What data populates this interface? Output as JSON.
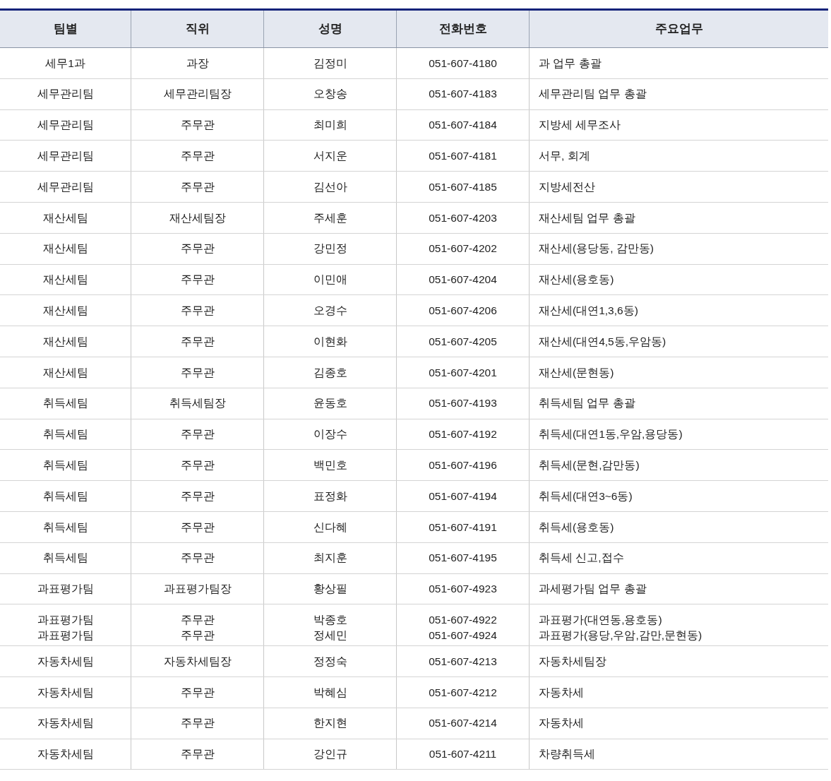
{
  "table": {
    "columns": [
      "팀별",
      "직위",
      "성명",
      "전화번호",
      "주요업무"
    ],
    "rows": [
      [
        "세무1과",
        "과장",
        "김정미",
        "051-607-4180",
        "과 업무 총괄"
      ],
      [
        "세무관리팀",
        "세무관리팀장",
        "오창송",
        "051-607-4183",
        "세무관리팀 업무 총괄"
      ],
      [
        "세무관리팀",
        "주무관",
        "최미희",
        "051-607-4184",
        "지방세 세무조사"
      ],
      [
        "세무관리팀",
        "주무관",
        "서지운",
        "051-607-4181",
        "서무, 회계"
      ],
      [
        "세무관리팀",
        "주무관",
        "김선아",
        "051-607-4185",
        "지방세전산"
      ],
      [
        "재산세팀",
        "재산세팀장",
        "주세훈",
        "051-607-4203",
        "재산세팀 업무 총괄"
      ],
      [
        "재산세팀",
        "주무관",
        "강민정",
        "051-607-4202",
        "재산세(용당동, 감만동)"
      ],
      [
        "재산세팀",
        "주무관",
        "이민애",
        "051-607-4204",
        "재산세(용호동)"
      ],
      [
        "재산세팀",
        "주무관",
        "오경수",
        "051-607-4206",
        "재산세(대연1,3,6동)"
      ],
      [
        "재산세팀",
        "주무관",
        "이현화",
        "051-607-4205",
        "재산세(대연4,5동,우암동)"
      ],
      [
        "재산세팀",
        "주무관",
        "김종호",
        "051-607-4201",
        "재산세(문현동)"
      ],
      [
        "취득세팀",
        "취득세팀장",
        "윤동호",
        "051-607-4193",
        "취득세팀 업무 총괄"
      ],
      [
        "취득세팀",
        "주무관",
        "이장수",
        "051-607-4192",
        "취득세(대연1동,우암,용당동)"
      ],
      [
        "취득세팀",
        "주무관",
        "백민호",
        "051-607-4196",
        "취득세(문현,감만동)"
      ],
      [
        "취득세팀",
        "주무관",
        "표정화",
        "051-607-4194",
        "취득세(대연3~6동)"
      ],
      [
        "취득세팀",
        "주무관",
        "신다혜",
        "051-607-4191",
        "취득세(용호동)"
      ],
      [
        "취득세팀",
        "주무관",
        "최지훈",
        "051-607-4195",
        "취득세 신고,접수"
      ],
      [
        "과표평가팀",
        "과표평가팀장",
        "황상필",
        "051-607-4923",
        "과세평가팀 업무 총괄"
      ],
      [
        "과표평가팀",
        "주무관",
        "박종호",
        "051-607-4922",
        "과표평가(대연동,용호동)"
      ],
      [
        "과표평가팀",
        "주무관",
        "정세민",
        "051-607-4924",
        "과표평가(용당,우암,감만,문현동)"
      ],
      [
        "자동차세팀",
        "자동차세팀장",
        "정정숙",
        "051-607-4213",
        "자동차세팀장"
      ],
      [
        "자동차세팀",
        "주무관",
        "박혜심",
        "051-607-4212",
        "자동차세"
      ],
      [
        "자동차세팀",
        "주무관",
        "한지현",
        "051-607-4214",
        "자동차세"
      ],
      [
        "자동차세팀",
        "주무관",
        "강인규",
        "051-607-4211",
        "차량취득세"
      ]
    ]
  }
}
